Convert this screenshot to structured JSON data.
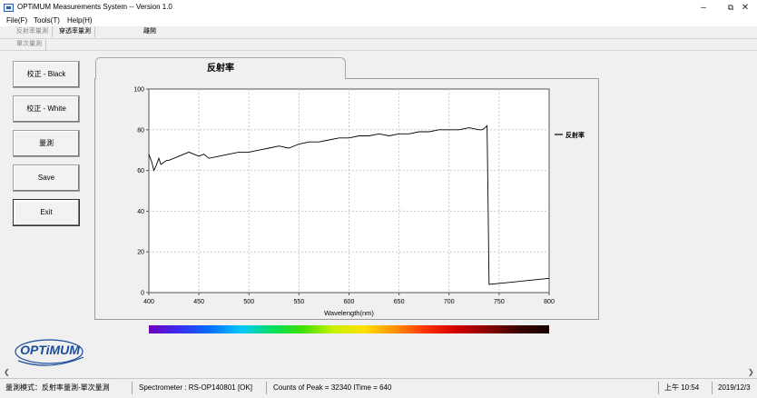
{
  "window": {
    "title": "OPTiMUM Measurements System -- Version 1.0"
  },
  "menu": [
    "File(F)",
    "Tools(T)",
    "Help(H)"
  ],
  "mode_tabs": [
    "反射率量測",
    "穿透率量測",
    "離開"
  ],
  "sub_tab": "單次量測",
  "side_buttons": {
    "calibrate_black": "校正 - Black",
    "calibrate_white": "校正 - White",
    "measure": "量測",
    "save": "Save",
    "exit": "Exit"
  },
  "chart_tab": {
    "label": "反射率"
  },
  "chart_data": {
    "type": "line",
    "xlabel": "Wavelength(nm)",
    "ylabel": "",
    "xlim": [
      400,
      800
    ],
    "ylim": [
      0,
      100
    ],
    "xticks": [
      400,
      450,
      500,
      550,
      600,
      650,
      700,
      750,
      800
    ],
    "yticks": [
      0,
      20,
      40,
      60,
      80,
      100
    ],
    "grid": true,
    "legend_position": "right",
    "series": [
      {
        "name": "反射率",
        "color": "#000000",
        "x": [
          400,
          403,
          405,
          407,
          410,
          412,
          415,
          418,
          420,
          425,
          430,
          435,
          440,
          445,
          450,
          455,
          460,
          470,
          480,
          490,
          500,
          510,
          520,
          530,
          540,
          550,
          560,
          570,
          580,
          590,
          600,
          610,
          620,
          630,
          640,
          650,
          660,
          670,
          680,
          690,
          700,
          710,
          720,
          730,
          733,
          736,
          738,
          739,
          740,
          760,
          780,
          800
        ],
        "y": [
          68,
          64,
          60,
          62,
          66,
          63,
          64,
          65,
          65,
          66,
          67,
          68,
          69,
          68,
          67,
          68,
          66,
          67,
          68,
          69,
          69,
          70,
          71,
          72,
          71,
          73,
          74,
          74,
          75,
          76,
          76,
          77,
          77,
          78,
          77,
          78,
          78,
          79,
          79,
          80,
          80,
          80,
          81,
          80,
          80,
          81,
          82,
          45,
          4,
          5,
          6,
          7
        ]
      }
    ]
  },
  "status": {
    "mode": "量測模式：反射率量測-單次量測",
    "spectrometer": "Spectrometer : RS-OP140801      [OK]",
    "counts": "Counts of Peak = 32340   ITime = 640",
    "time": "上午 10:54",
    "date": "2019/12/3"
  },
  "logo": {
    "text": "OPTiMUM"
  }
}
